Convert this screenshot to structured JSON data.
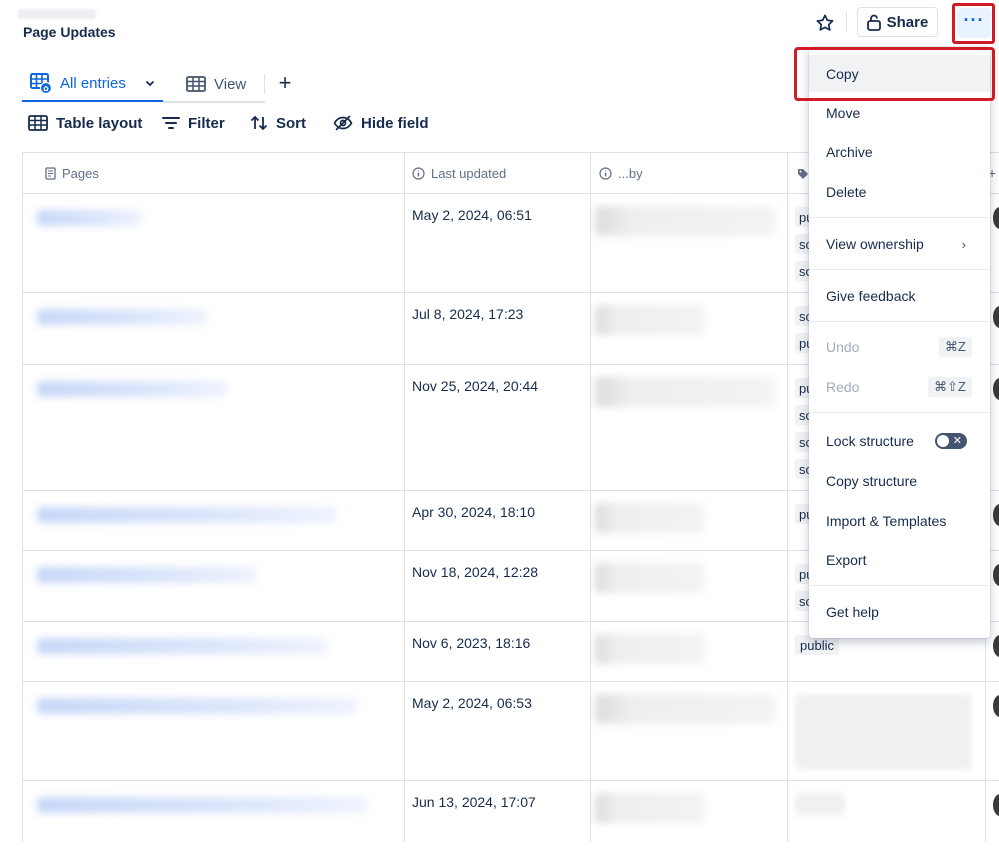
{
  "header": {
    "title": "Page Updates",
    "share_label": "Share",
    "more_label": "···"
  },
  "tabs": {
    "all_entries": "All entries",
    "view": "View",
    "add": "+"
  },
  "toolbar": {
    "table_layout": "Table layout",
    "filter": "Filter",
    "sort": "Sort",
    "hide_field": "Hide field"
  },
  "table": {
    "columns": {
      "pages": "Pages",
      "last_updated": "Last updated",
      "by": "...by"
    },
    "rows": [
      {
        "last_updated": "May 2, 2024, 06:51",
        "tags": [
          "pu",
          "so",
          "so"
        ]
      },
      {
        "last_updated": "Jul 8, 2024, 17:23",
        "tags": [
          "so",
          "pu"
        ]
      },
      {
        "last_updated": "Nov 25, 2024, 20:44",
        "tags": [
          "pu",
          "so",
          "so",
          "so"
        ]
      },
      {
        "last_updated": "Apr 30, 2024, 18:10",
        "tags": [
          "pu"
        ]
      },
      {
        "last_updated": "Nov 18, 2024, 12:28",
        "tags": [
          "pu",
          "so"
        ]
      },
      {
        "last_updated": "Nov 6, 2023, 18:16",
        "tags": [
          "public"
        ]
      },
      {
        "last_updated": "May 2, 2024, 06:53",
        "tags": []
      },
      {
        "last_updated": "Jun 13, 2024, 17:07",
        "tags": []
      }
    ]
  },
  "menu": {
    "copy": "Copy",
    "move": "Move",
    "archive": "Archive",
    "delete": "Delete",
    "view_ownership": "View ownership",
    "give_feedback": "Give feedback",
    "undo": "Undo",
    "undo_shortcut": "⌘Z",
    "redo": "Redo",
    "redo_shortcut": "⌘⇧Z",
    "lock_structure": "Lock structure",
    "copy_structure": "Copy structure",
    "import_templates": "Import & Templates",
    "export": "Export",
    "get_help": "Get help"
  },
  "colors": {
    "accent": "#0c66e4",
    "highlight": "#d01c26",
    "text": "#172b4d",
    "muted": "#626f86"
  }
}
